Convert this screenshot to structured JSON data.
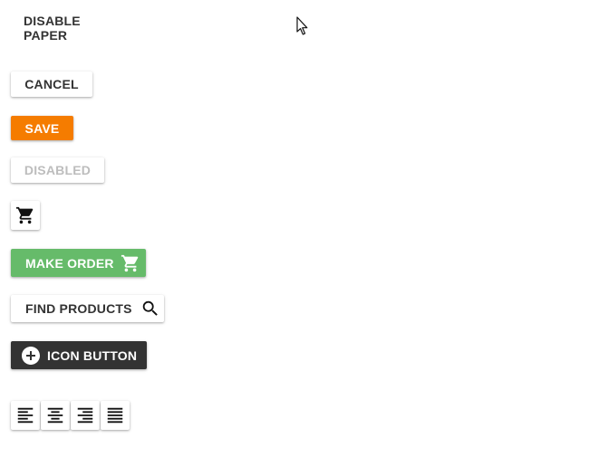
{
  "colors": {
    "save_bg": "#f57c00",
    "make_order_bg": "#66bb6a",
    "icon_button_bg": "#333333",
    "text_dark": "#333333",
    "text_disabled": "#bdbdbd"
  },
  "buttons": {
    "disable_paper": "DISABLE PAPER",
    "cancel": "CANCEL",
    "save": "SAVE",
    "disabled": "DISABLED",
    "make_order": "MAKE ORDER",
    "find_products": "FIND PRODUCTS",
    "icon_button": "ICON BUTTON"
  },
  "icons": {
    "cart_button": "shopping-cart-icon",
    "make_order": "shopping-cart-icon",
    "find_products": "search-icon",
    "icon_button": "add-circle-icon",
    "align": [
      "format-align-left-icon",
      "format-align-center-icon",
      "format-align-right-icon",
      "format-align-justify-icon"
    ]
  }
}
